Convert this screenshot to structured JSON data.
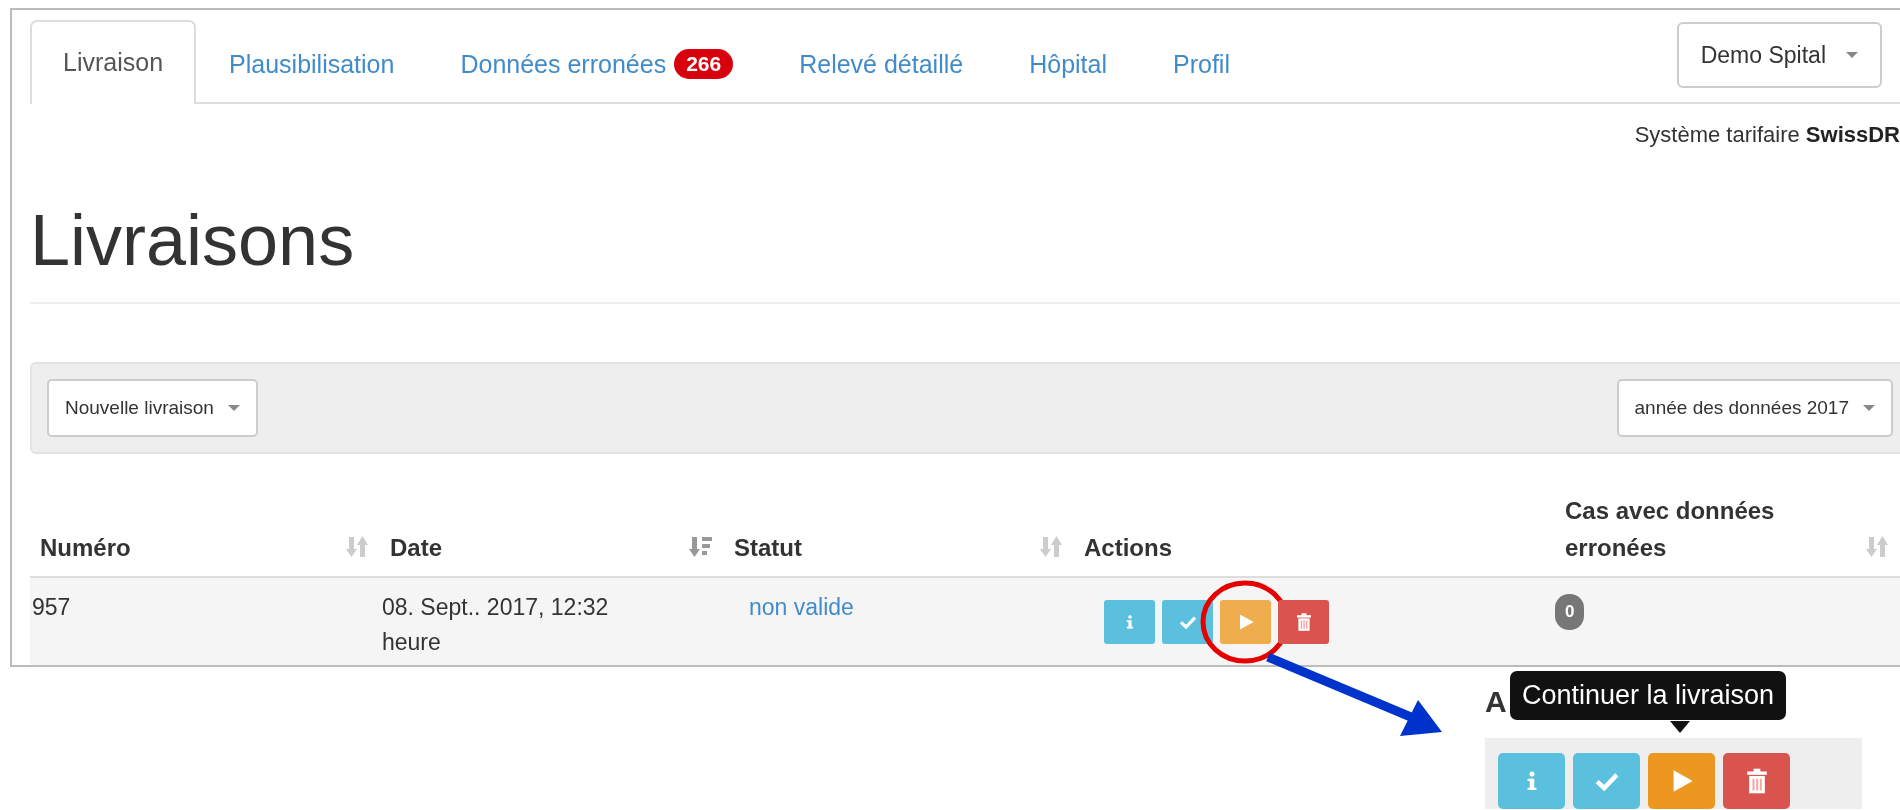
{
  "tabs": [
    {
      "label": "Livraison",
      "selected": true
    },
    {
      "label": "Plausibilisation",
      "selected": false
    },
    {
      "label": "Données erronées",
      "selected": false,
      "badge": "266"
    },
    {
      "label": "Relevé détaillé",
      "selected": false
    },
    {
      "label": "Hôpital",
      "selected": false
    },
    {
      "label": "Profil",
      "selected": false
    }
  ],
  "hospital_dropdown": "Demo Spital",
  "tariff_system": "Système tarifaire **SwissDR**",
  "page_title": "Livraisons",
  "toolbar": {
    "new_delivery_button": "Nouvelle livraison",
    "data_year_dropdown": "année des données 2017"
  },
  "table": {
    "columns": [
      {
        "label": "Numéro",
        "sortable": true,
        "sorted_descending": false
      },
      {
        "label": "Date",
        "sortable": true,
        "sorted_descending": true
      },
      {
        "label": "Statut",
        "sortable": true,
        "sorted_descending": false
      },
      {
        "label": "Actions",
        "sortable": false,
        "sorted_descending": false
      },
      {
        "label": "Cas avec données erronées",
        "sortable": true,
        "sorted_descending": false
      }
    ],
    "rows": [
      {
        "number": "957",
        "date": "08. Sept.. 2017, 12:32 heure",
        "status": "non valide",
        "actions": [
          {
            "kind": "info",
            "highlighted": false
          },
          {
            "kind": "validate",
            "highlighted": false
          },
          {
            "kind": "continue",
            "highlighted": true
          },
          {
            "kind": "delete",
            "highlighted": false
          }
        ],
        "error_cases": "0"
      }
    ]
  },
  "callout": {
    "heading": "A",
    "tooltip": "Continuer la livraison",
    "actions": [
      {
        "kind": "info"
      },
      {
        "kind": "validate"
      },
      {
        "kind": "continue"
      },
      {
        "kind": "delete"
      }
    ]
  }
}
